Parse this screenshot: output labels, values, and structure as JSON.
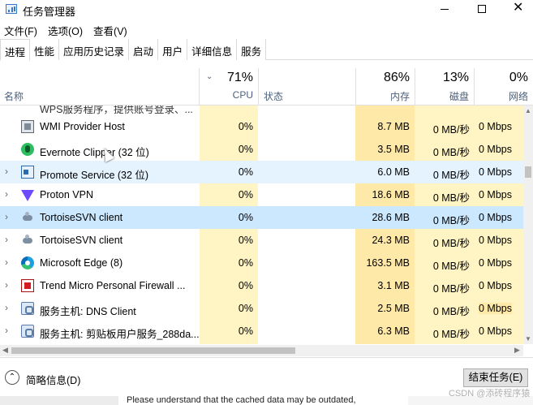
{
  "window": {
    "title": "任务管理器",
    "close_glyph": "✕"
  },
  "menu": [
    "文件(F)",
    "选项(O)",
    "查看(V)"
  ],
  "tabs": [
    "进程",
    "性能",
    "应用历史记录",
    "启动",
    "用户",
    "详细信息",
    "服务"
  ],
  "header": {
    "name": "名称",
    "status": "状态",
    "cpu": {
      "pct": "71%",
      "label": "CPU"
    },
    "memory": {
      "pct": "86%",
      "label": "内存"
    },
    "disk": {
      "pct": "13%",
      "label": "磁盘"
    },
    "network": {
      "pct": "0%",
      "label": "网络"
    }
  },
  "partial_row_text": "WPS服务程序，提供账号登录、...",
  "rows": [
    {
      "name": "WMI Provider Host",
      "cpu": "0%",
      "memory": "8.7 MB",
      "disk": "0 MB/秒",
      "network": "0 Mbps",
      "icon": "wmi-icon",
      "expandable": false
    },
    {
      "name": "Evernote Clipper (32 位)",
      "cpu": "0%",
      "memory": "3.5 MB",
      "disk": "0 MB/秒",
      "network": "0 Mbps",
      "icon": "evernote-icon",
      "expandable": false
    },
    {
      "name": "Promote Service (32 位)",
      "cpu": "0%",
      "memory": "6.0 MB",
      "disk": "0 MB/秒",
      "network": "0 Mbps",
      "icon": "service-window-icon",
      "expandable": true
    },
    {
      "name": "Proton VPN",
      "cpu": "0%",
      "memory": "18.6 MB",
      "disk": "0 MB/秒",
      "network": "0 Mbps",
      "icon": "proton-vpn-icon",
      "expandable": true
    },
    {
      "name": "TortoiseSVN client",
      "cpu": "0%",
      "memory": "28.6 MB",
      "disk": "0 MB/秒",
      "network": "0 Mbps",
      "icon": "tortoisesvn-icon",
      "expandable": true
    },
    {
      "name": "TortoiseSVN client",
      "cpu": "0%",
      "memory": "24.3 MB",
      "disk": "0 MB/秒",
      "network": "0 Mbps",
      "icon": "tortoisesvn-icon",
      "expandable": true
    },
    {
      "name": "Microsoft Edge (8)",
      "cpu": "0%",
      "memory": "163.5 MB",
      "disk": "0 MB/秒",
      "network": "0 Mbps",
      "icon": "edge-icon",
      "expandable": true
    },
    {
      "name": "Trend Micro Personal Firewall ...",
      "cpu": "0%",
      "memory": "3.1 MB",
      "disk": "0 MB/秒",
      "network": "0 Mbps",
      "icon": "trend-micro-icon",
      "expandable": true
    },
    {
      "name": "服务主机: DNS Client",
      "cpu": "0%",
      "memory": "2.5 MB",
      "disk": "0 MB/秒",
      "network": "0 Mbps",
      "icon": "service-host-gear-icon",
      "expandable": true
    },
    {
      "name": "服务主机: 剪贴板用户服务_288da...",
      "cpu": "0%",
      "memory": "6.3 MB",
      "disk": "0 MB/秒",
      "network": "0 Mbps",
      "icon": "service-host-gear-icon",
      "expandable": true
    }
  ],
  "footer": {
    "collapse_label": "简略信息(D)",
    "end_task": "结束任务(E)"
  },
  "background_text": "Please understand that the cached data may be outdated,",
  "watermark": "CSDN @添砖程序猿",
  "colors": {
    "cpu_column": "#fff4c4",
    "memory_column": "#ffe9a8",
    "selected_row": "#cce8ff",
    "hover_row": "#e5f3ff"
  }
}
